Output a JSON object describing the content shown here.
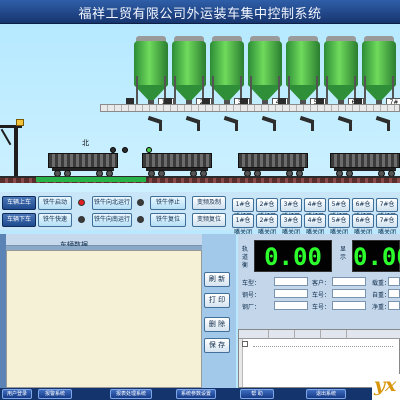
{
  "window": {
    "title": "福祥工贸有限公司外运装车集中控制系统"
  },
  "scene": {
    "silo_labels": [
      "1#",
      "2#",
      "3#",
      "4#",
      "5#",
      "6#",
      "7#"
    ],
    "north_label": "北",
    "colors": {
      "silo": "#3ca044",
      "rail": "#5a2d2d",
      "rail_active": "#27b34a",
      "indicator_on": "#4ec84e"
    }
  },
  "controls": {
    "row1": {
      "b1": "车辆上车",
      "b2": "铁牛启动",
      "b3": "铁牛向北运行",
      "b4": "铁牛停止",
      "b5": "变频及制"
    },
    "row2": {
      "b1": "车辆下车",
      "b2": "铁牛快速",
      "b3": "铁牛向南运行",
      "b4": "铁牛复位",
      "b5": "变频复位"
    },
    "gate_buttons_top": [
      "1#仓嘴打开",
      "2#仓嘴打开",
      "3#仓嘴打开",
      "4#仓嘴打开",
      "5#仓嘴打开",
      "6#仓嘴打开",
      "7#仓嘴打开"
    ],
    "gate_buttons_bottom": [
      "1#仓嘴关闭",
      "2#仓嘴关闭",
      "3#仓嘴关闭",
      "4#仓嘴关闭",
      "5#仓嘴关闭",
      "6#仓嘴关闭",
      "7#仓嘴关闭"
    ]
  },
  "left_panel": {
    "title": "车辆数据",
    "buttons": {
      "refresh": "刷 新",
      "print": "打 印",
      "delete": "删 除",
      "save": "保 存"
    }
  },
  "right_panel": {
    "rail_scale_label": "轨道衡",
    "display_left": "0.00",
    "display_right_label": "显示",
    "display_right": "0.00",
    "fields_left": [
      "车型：",
      "钢号：",
      "钢厂："
    ],
    "fields_mid": [
      "客户：",
      "车号：",
      "车号："
    ],
    "fields_right": [
      "载重：",
      "自重：",
      "净重："
    ]
  },
  "bottom_bar": {
    "buttons": [
      "用户登录",
      "报警系统",
      "报表处理系统",
      "系统参数设置",
      "帮 助",
      "退出系统"
    ]
  },
  "logo": {
    "text": "yx"
  }
}
